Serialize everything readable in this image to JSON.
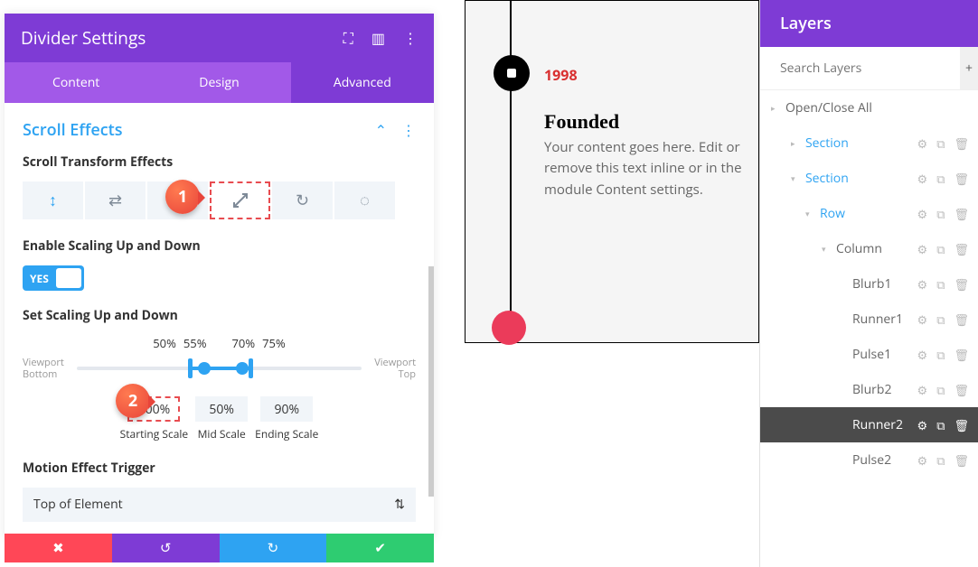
{
  "header": {
    "title": "Divider Settings"
  },
  "tabs": {
    "content": "Content",
    "design": "Design",
    "advanced": "Advanced"
  },
  "section": {
    "title": "Scroll Effects"
  },
  "effects": {
    "label": "Scroll Transform Effects"
  },
  "enable": {
    "label": "Enable Scaling Up and Down",
    "value": "YES"
  },
  "scaling": {
    "label": "Set Scaling Up and Down",
    "ticks": [
      "50%",
      "55%",
      "70%",
      "75%"
    ],
    "vp_bottom": "Viewport Bottom",
    "vp_top": "Viewport Top",
    "start": "100%",
    "mid": "50%",
    "end": "90%",
    "start_lbl": "Starting Scale",
    "mid_lbl": "Mid Scale",
    "end_lbl": "Ending Scale"
  },
  "trigger": {
    "label": "Motion Effect Trigger",
    "value": "Top of Element"
  },
  "preview": {
    "year": "1998",
    "title": "Founded",
    "body": "Your content goes here. Edit or remove this text inline or in the module Content settings."
  },
  "layers": {
    "title": "Layers",
    "search": "Search Layers",
    "openclose": "Open/Close All",
    "items": [
      {
        "label": "Section",
        "cls": "lvl1 blue-txt",
        "caret": "▸"
      },
      {
        "label": "Section",
        "cls": "lvl1 blue-txt",
        "caret": "▾"
      },
      {
        "label": "Row",
        "cls": "lvl2 blue-txt",
        "caret": "▾"
      },
      {
        "label": "Column",
        "cls": "lvl3",
        "caret": "▾"
      },
      {
        "label": "Blurb1",
        "cls": "lvl4",
        "caret": ""
      },
      {
        "label": "Runner1",
        "cls": "lvl4",
        "caret": ""
      },
      {
        "label": "Pulse1",
        "cls": "lvl4",
        "caret": ""
      },
      {
        "label": "Blurb2",
        "cls": "lvl4",
        "caret": ""
      },
      {
        "label": "Runner2",
        "cls": "lvl4",
        "caret": "",
        "sel": true
      },
      {
        "label": "Pulse2",
        "cls": "lvl4",
        "caret": ""
      }
    ]
  },
  "callouts": {
    "one": "1",
    "two": "2"
  }
}
